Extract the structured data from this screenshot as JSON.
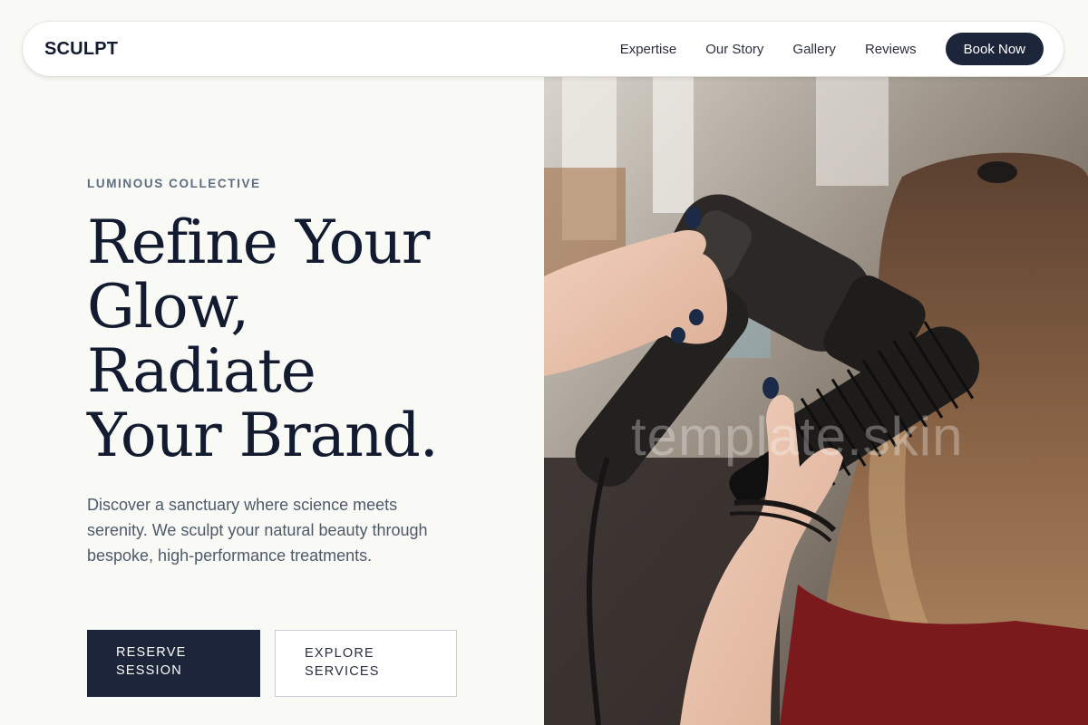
{
  "nav": {
    "logo": "SCULPT",
    "links": [
      "Expertise",
      "Our Story",
      "Gallery",
      "Reviews"
    ],
    "cta": "Book Now"
  },
  "hero": {
    "eyebrow": "LUMINOUS COLLECTIVE",
    "headline_lines": [
      "Refine Your",
      "Glow,",
      "Radiate",
      "Your Brand."
    ],
    "description": "Discover a sanctuary where science meets serenity. We sculpt your natural beauty through bespoke, high-performance treatments.",
    "primary_button": "RESERVE SESSION",
    "secondary_button": "EXPLORE SERVICES"
  },
  "watermark": "template.skin",
  "colors": {
    "navy": "#1c2539",
    "background": "#f9f9f6",
    "heading": "#121b30",
    "muted": "#4e5a6c"
  }
}
